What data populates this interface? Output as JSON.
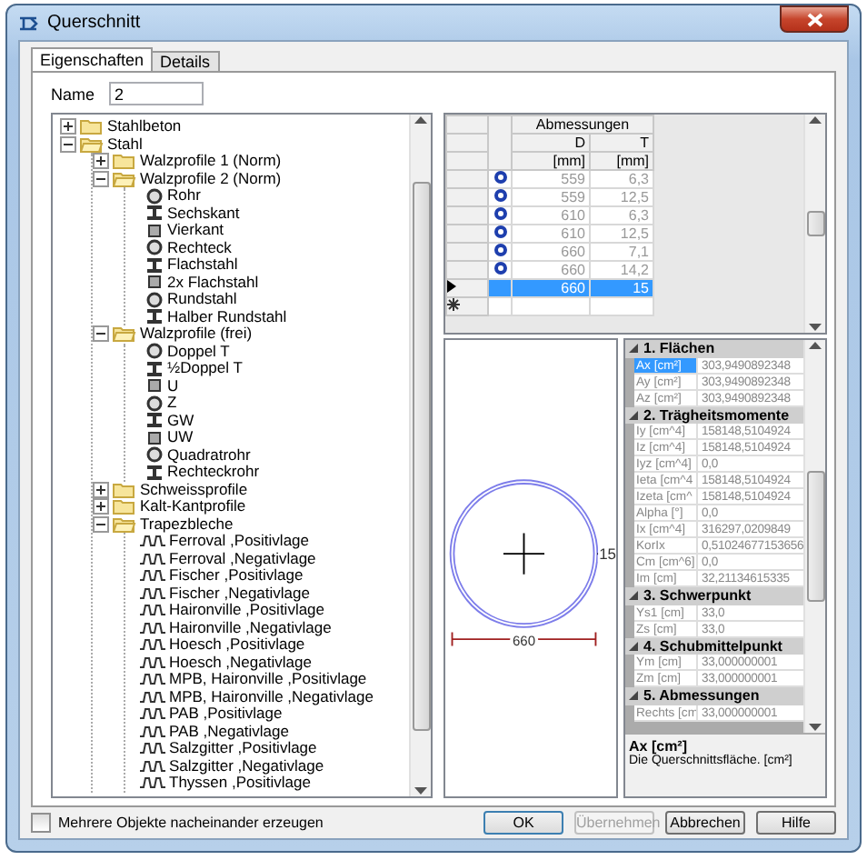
{
  "window": {
    "title": "Querschnitt"
  },
  "tabs": [
    {
      "label": "Eigenschaften",
      "selected": true
    },
    {
      "label": "Details",
      "selected": false
    }
  ],
  "name_field": {
    "label": "Name",
    "value": "2"
  },
  "tree": [
    {
      "label": "Stahlbeton",
      "kind": "folder",
      "expanded": false
    },
    {
      "label": "Stahl",
      "kind": "folder",
      "expanded": true,
      "children": [
        {
          "label": "Walzprofile 1 (Norm)",
          "kind": "folder",
          "expanded": false
        },
        {
          "label": "Walzprofile 2 (Norm)",
          "kind": "folder",
          "expanded": true,
          "children": [
            {
              "label": "Rohr",
              "kind": "section"
            },
            {
              "label": "Sechskant",
              "kind": "section"
            },
            {
              "label": "Vierkant",
              "kind": "section"
            },
            {
              "label": "Rechteck",
              "kind": "section"
            },
            {
              "label": "Flachstahl",
              "kind": "section"
            },
            {
              "label": "2x Flachstahl",
              "kind": "section"
            },
            {
              "label": "Rundstahl",
              "kind": "section"
            },
            {
              "label": "Halber Rundstahl",
              "kind": "section"
            }
          ]
        },
        {
          "label": "Walzprofile (frei)",
          "kind": "folder",
          "expanded": true,
          "children": [
            {
              "label": "Doppel T",
              "kind": "section"
            },
            {
              "label": "½Doppel T",
              "kind": "section"
            },
            {
              "label": "U",
              "kind": "section"
            },
            {
              "label": "Z",
              "kind": "section"
            },
            {
              "label": "GW",
              "kind": "section"
            },
            {
              "label": "UW",
              "kind": "section"
            },
            {
              "label": "Quadratrohr",
              "kind": "section"
            },
            {
              "label": "Rechteckrohr",
              "kind": "section"
            }
          ]
        },
        {
          "label": "Schweissprofile",
          "kind": "folder",
          "expanded": false
        },
        {
          "label": "Kalt-Kantprofile",
          "kind": "folder",
          "expanded": false
        },
        {
          "label": "Trapezbleche",
          "kind": "folder",
          "expanded": true,
          "children": [
            {
              "label": "Ferroval ,Positivlage",
              "kind": "sheet"
            },
            {
              "label": "Ferroval ,Negativlage",
              "kind": "sheet"
            },
            {
              "label": "Fischer ,Positivlage",
              "kind": "sheet"
            },
            {
              "label": "Fischer ,Negativlage",
              "kind": "sheet"
            },
            {
              "label": "Haironville ,Positivlage",
              "kind": "sheet"
            },
            {
              "label": "Haironville ,Negativlage",
              "kind": "sheet"
            },
            {
              "label": "Hoesch ,Positivlage",
              "kind": "sheet"
            },
            {
              "label": "Hoesch ,Negativlage",
              "kind": "sheet"
            },
            {
              "label": "MPB, Haironville ,Positivlage",
              "kind": "sheet"
            },
            {
              "label": "MPB, Haironville ,Negativlage",
              "kind": "sheet"
            },
            {
              "label": "PAB ,Positivlage",
              "kind": "sheet"
            },
            {
              "label": "PAB ,Negativlage",
              "kind": "sheet"
            },
            {
              "label": "Salzgitter ,Positivlage",
              "kind": "sheet"
            },
            {
              "label": "Salzgitter ,Negativlage",
              "kind": "sheet"
            },
            {
              "label": "Thyssen ,Positivlage",
              "kind": "sheet"
            }
          ]
        }
      ]
    }
  ],
  "dimensions_table": {
    "group": "Abmessungen",
    "columns": [
      {
        "name": "D",
        "unit": "[mm]"
      },
      {
        "name": "T",
        "unit": "[mm]"
      }
    ],
    "rows": [
      {
        "cells": [
          "559",
          "6,3"
        ],
        "selected": false
      },
      {
        "cells": [
          "559",
          "12,5"
        ],
        "selected": false
      },
      {
        "cells": [
          "610",
          "6,3"
        ],
        "selected": false
      },
      {
        "cells": [
          "610",
          "12,5"
        ],
        "selected": false
      },
      {
        "cells": [
          "660",
          "7,1"
        ],
        "selected": false
      },
      {
        "cells": [
          "660",
          "14,2"
        ],
        "selected": false
      },
      {
        "cells": [
          "660",
          "15"
        ],
        "selected": true
      }
    ]
  },
  "drawing": {
    "diameter_label": "660",
    "thickness_label": "15"
  },
  "properties": [
    {
      "title": "1. Flächen",
      "expanded": true,
      "rows": [
        {
          "name": "Ax [cm²]",
          "value": "303,9490892348",
          "selected": true
        },
        {
          "name": "Ay [cm²]",
          "value": "303,9490892348",
          "selected": false
        },
        {
          "name": "Az [cm²]",
          "value": "303,9490892348",
          "selected": false
        }
      ]
    },
    {
      "title": "2. Trägheitsmomente",
      "expanded": true,
      "rows": [
        {
          "name": "Iy [cm^4]",
          "value": "158148,5104924",
          "selected": false
        },
        {
          "name": "Iz [cm^4]",
          "value": "158148,5104924",
          "selected": false
        },
        {
          "name": "Iyz [cm^4]",
          "value": "0,0",
          "selected": false
        },
        {
          "name": "Ieta [cm^4",
          "value": "158148,5104924",
          "selected": false
        },
        {
          "name": "Izeta [cm^",
          "value": "158148,5104924",
          "selected": false
        },
        {
          "name": "Alpha [°]",
          "value": "0,0",
          "selected": false
        },
        {
          "name": "Ix [cm^4]",
          "value": "316297,0209849",
          "selected": false
        },
        {
          "name": "KorIx",
          "value": "0,51024677153656",
          "selected": false
        },
        {
          "name": "Cm [cm^6]",
          "value": "0,0",
          "selected": false
        },
        {
          "name": "Im [cm]",
          "value": "32,21134615335",
          "selected": false
        }
      ]
    },
    {
      "title": "3. Schwerpunkt",
      "expanded": true,
      "rows": [
        {
          "name": "Ys1 [cm]",
          "value": "33,0",
          "selected": false
        },
        {
          "name": "Zs [cm]",
          "value": "33,0",
          "selected": false
        }
      ]
    },
    {
      "title": "4. Schubmittelpunkt",
      "expanded": true,
      "rows": [
        {
          "name": "Ym [cm]",
          "value": "33,000000001",
          "selected": false
        },
        {
          "name": "Zm [cm]",
          "value": "33,000000001",
          "selected": false
        }
      ]
    },
    {
      "title": "5. Abmessungen",
      "expanded": true,
      "rows": [
        {
          "name": "Rechts [cm",
          "value": "33,000000001",
          "selected": false
        }
      ]
    }
  ],
  "description": {
    "title": "Ax [cm²]",
    "text": "Die Querschnittsfläche. [cm²]"
  },
  "checkbox": {
    "label": "Mehrere Objekte nacheinander erzeugen",
    "checked": false
  },
  "buttons": [
    {
      "label": "OK",
      "disabled": false
    },
    {
      "label": "Übernehmen",
      "disabled": true
    },
    {
      "label": "Abbrechen",
      "disabled": false
    },
    {
      "label": "Hilfe",
      "disabled": false
    }
  ]
}
